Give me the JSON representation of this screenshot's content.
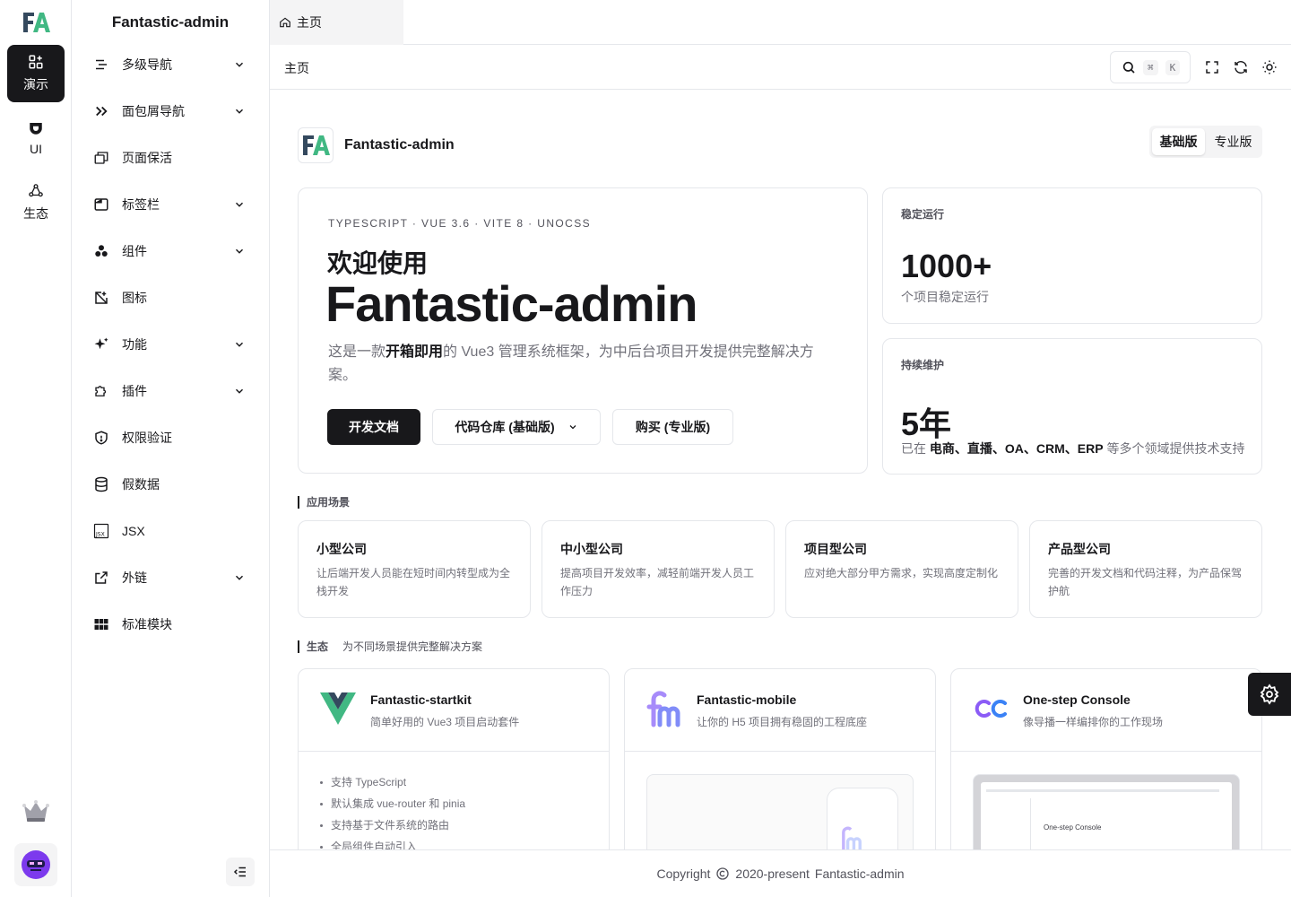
{
  "rail": {
    "items": [
      {
        "label": "演示",
        "icon": "grid-plus-icon"
      },
      {
        "label": "UI",
        "icon": "cup-icon"
      },
      {
        "label": "生态",
        "icon": "ecosystem-icon"
      }
    ]
  },
  "sidebar": {
    "title": "Fantastic-admin",
    "items": [
      {
        "label": "多级导航",
        "icon": "multi-level-icon",
        "has_children": true
      },
      {
        "label": "面包屑导航",
        "icon": "double-chevron-icon",
        "has_children": true
      },
      {
        "label": "页面保活",
        "icon": "windows-icon",
        "has_children": false
      },
      {
        "label": "标签栏",
        "icon": "tabbar-icon",
        "has_children": true
      },
      {
        "label": "组件",
        "icon": "components-icon",
        "has_children": true
      },
      {
        "label": "图标",
        "icon": "image-icon",
        "has_children": false
      },
      {
        "label": "功能",
        "icon": "sparkles-icon",
        "has_children": true
      },
      {
        "label": "插件",
        "icon": "puzzle-icon",
        "has_children": true
      },
      {
        "label": "权限验证",
        "icon": "shield-icon",
        "has_children": false
      },
      {
        "label": "假数据",
        "icon": "database-icon",
        "has_children": false
      },
      {
        "label": "JSX",
        "icon": "jsx-icon",
        "has_children": false
      },
      {
        "label": "外链",
        "icon": "external-link-icon",
        "has_children": true
      },
      {
        "label": "标准模块",
        "icon": "apps-icon",
        "has_children": false
      }
    ]
  },
  "tabs": [
    {
      "label": "主页",
      "icon": "home-icon"
    }
  ],
  "toolbar": {
    "breadcrumb": "主页",
    "search_kbd": [
      "⌘",
      "K"
    ]
  },
  "brand": {
    "name": "Fantastic-admin"
  },
  "edition_switch": {
    "options": [
      "基础版",
      "专业版"
    ],
    "selected": "基础版"
  },
  "hero": {
    "tags": "TYPESCRIPT · VUE 3.6 · VITE 8 · UNOCSS",
    "welcome": "欢迎使用",
    "name": "Fantastic-admin",
    "desc_pre": "这是一款",
    "desc_bold": "开箱即用",
    "desc_post": "的 Vue3 管理系统框架，为中后台项目开发提供完整解决方案。",
    "buttons": {
      "docs": "开发文档",
      "repo": "代码仓库 (基础版)",
      "buy": "购买 (专业版)"
    }
  },
  "stats": [
    {
      "label": "稳定运行",
      "value": "1000+",
      "sub": "个项目稳定运行"
    },
    {
      "label": "持续维护",
      "value": "5年",
      "sub_pre": "已在 ",
      "sub_bold": "电商、直播、OA、CRM、ERP",
      "sub_post": " 等多个领域提供技术支持"
    }
  ],
  "scenarios": {
    "title": "应用场景",
    "items": [
      {
        "title": "小型公司",
        "desc": "让后端开发人员能在短时间内转型成为全栈开发"
      },
      {
        "title": "中小型公司",
        "desc": "提高项目开发效率，减轻前端开发人员工作压力"
      },
      {
        "title": "项目型公司",
        "desc": "应对绝大部分甲方需求，实现高度定制化"
      },
      {
        "title": "产品型公司",
        "desc": "完善的开发文档和代码注释，为产品保驾护航"
      }
    ]
  },
  "ecosystem": {
    "title": "生态",
    "subtitle": "为不同场景提供完整解决方案",
    "items": [
      {
        "title": "Fantastic-startkit",
        "desc": "简单好用的 Vue3 项目启动套件",
        "features": [
          "支持 TypeScript",
          "默认集成 vue-router 和 pinia",
          "支持基于文件系统的路由",
          "全局组件自动引入"
        ]
      },
      {
        "title": "Fantastic-mobile",
        "desc": "让你的 H5 项目拥有稳固的工程底座"
      },
      {
        "title": "One-step Console",
        "desc": "像导播一样编排你的工作现场",
        "preview_text": "One-step Console"
      }
    ]
  },
  "footer": {
    "copyright": "Copyright",
    "years": "2020-present",
    "name": "Fantastic-admin"
  },
  "colors": {
    "accent": "#18181b",
    "border": "#e5e7eb",
    "muted": "#71717a",
    "brand_green": "#41b883",
    "brand_navy": "#34495e"
  }
}
